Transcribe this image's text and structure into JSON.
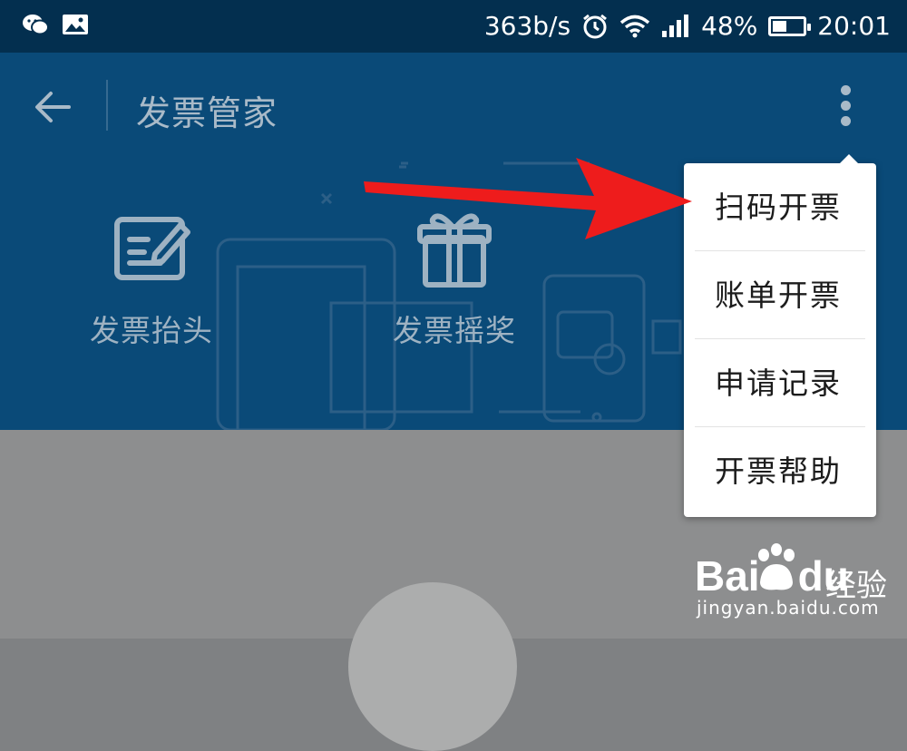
{
  "status_bar": {
    "speed": "363b/s",
    "battery": "48%",
    "battery_level": 0.48,
    "time": "20:01",
    "left_icons": [
      "wechat-icon",
      "image-icon"
    ],
    "right_icons": [
      "alarm-icon",
      "wifi-icon",
      "signal-icon",
      "battery-icon"
    ]
  },
  "app_bar": {
    "title": "发票管家",
    "back_icon": "arrow-left-icon",
    "more_icon": "more-vertical-icon"
  },
  "actions": [
    {
      "label": "发票抬头",
      "icon": "edit-document-icon"
    },
    {
      "label": "发票摇奖",
      "icon": "gift-icon"
    }
  ],
  "menu": {
    "items": [
      "扫码开票",
      "账单开票",
      "申请记录",
      "开票帮助"
    ]
  },
  "watermark": {
    "logo": "Bai",
    "logo_suffix": "du",
    "product": "经验",
    "url": "jingyan.baidu.com"
  },
  "colors": {
    "status_bar_bg": "#032f4f",
    "header_bg": "#0a4a78",
    "overlay_bg": "#8d8e8f",
    "arrow": "#ee1c1c",
    "menu_bg": "#ffffff"
  }
}
